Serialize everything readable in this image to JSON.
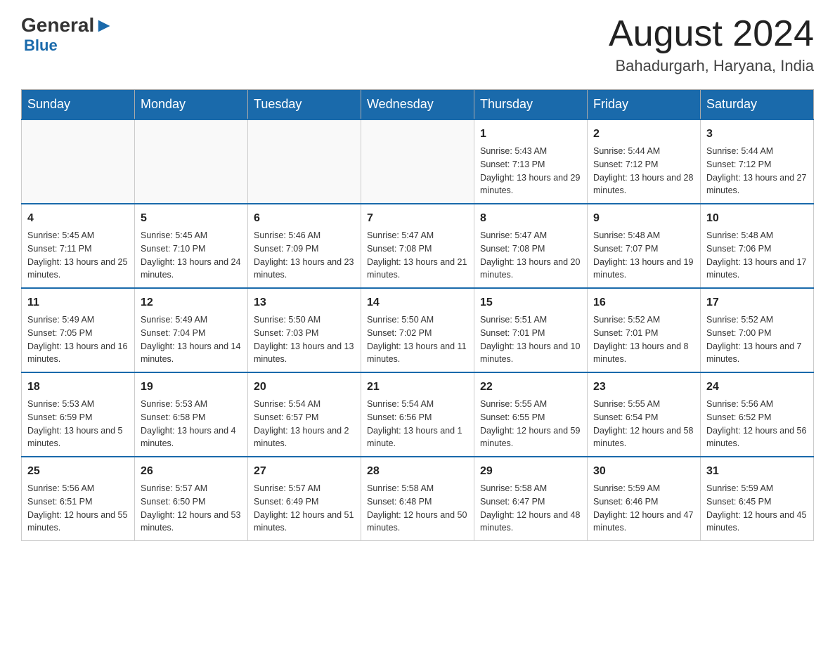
{
  "header": {
    "logo_general": "General",
    "logo_blue": "Blue",
    "month_title": "August 2024",
    "location": "Bahadurgarh, Haryana, India"
  },
  "calendar": {
    "days_of_week": [
      "Sunday",
      "Monday",
      "Tuesday",
      "Wednesday",
      "Thursday",
      "Friday",
      "Saturday"
    ],
    "weeks": [
      [
        {
          "day": "",
          "info": ""
        },
        {
          "day": "",
          "info": ""
        },
        {
          "day": "",
          "info": ""
        },
        {
          "day": "",
          "info": ""
        },
        {
          "day": "1",
          "info": "Sunrise: 5:43 AM\nSunset: 7:13 PM\nDaylight: 13 hours and 29 minutes."
        },
        {
          "day": "2",
          "info": "Sunrise: 5:44 AM\nSunset: 7:12 PM\nDaylight: 13 hours and 28 minutes."
        },
        {
          "day": "3",
          "info": "Sunrise: 5:44 AM\nSunset: 7:12 PM\nDaylight: 13 hours and 27 minutes."
        }
      ],
      [
        {
          "day": "4",
          "info": "Sunrise: 5:45 AM\nSunset: 7:11 PM\nDaylight: 13 hours and 25 minutes."
        },
        {
          "day": "5",
          "info": "Sunrise: 5:45 AM\nSunset: 7:10 PM\nDaylight: 13 hours and 24 minutes."
        },
        {
          "day": "6",
          "info": "Sunrise: 5:46 AM\nSunset: 7:09 PM\nDaylight: 13 hours and 23 minutes."
        },
        {
          "day": "7",
          "info": "Sunrise: 5:47 AM\nSunset: 7:08 PM\nDaylight: 13 hours and 21 minutes."
        },
        {
          "day": "8",
          "info": "Sunrise: 5:47 AM\nSunset: 7:08 PM\nDaylight: 13 hours and 20 minutes."
        },
        {
          "day": "9",
          "info": "Sunrise: 5:48 AM\nSunset: 7:07 PM\nDaylight: 13 hours and 19 minutes."
        },
        {
          "day": "10",
          "info": "Sunrise: 5:48 AM\nSunset: 7:06 PM\nDaylight: 13 hours and 17 minutes."
        }
      ],
      [
        {
          "day": "11",
          "info": "Sunrise: 5:49 AM\nSunset: 7:05 PM\nDaylight: 13 hours and 16 minutes."
        },
        {
          "day": "12",
          "info": "Sunrise: 5:49 AM\nSunset: 7:04 PM\nDaylight: 13 hours and 14 minutes."
        },
        {
          "day": "13",
          "info": "Sunrise: 5:50 AM\nSunset: 7:03 PM\nDaylight: 13 hours and 13 minutes."
        },
        {
          "day": "14",
          "info": "Sunrise: 5:50 AM\nSunset: 7:02 PM\nDaylight: 13 hours and 11 minutes."
        },
        {
          "day": "15",
          "info": "Sunrise: 5:51 AM\nSunset: 7:01 PM\nDaylight: 13 hours and 10 minutes."
        },
        {
          "day": "16",
          "info": "Sunrise: 5:52 AM\nSunset: 7:01 PM\nDaylight: 13 hours and 8 minutes."
        },
        {
          "day": "17",
          "info": "Sunrise: 5:52 AM\nSunset: 7:00 PM\nDaylight: 13 hours and 7 minutes."
        }
      ],
      [
        {
          "day": "18",
          "info": "Sunrise: 5:53 AM\nSunset: 6:59 PM\nDaylight: 13 hours and 5 minutes."
        },
        {
          "day": "19",
          "info": "Sunrise: 5:53 AM\nSunset: 6:58 PM\nDaylight: 13 hours and 4 minutes."
        },
        {
          "day": "20",
          "info": "Sunrise: 5:54 AM\nSunset: 6:57 PM\nDaylight: 13 hours and 2 minutes."
        },
        {
          "day": "21",
          "info": "Sunrise: 5:54 AM\nSunset: 6:56 PM\nDaylight: 13 hours and 1 minute."
        },
        {
          "day": "22",
          "info": "Sunrise: 5:55 AM\nSunset: 6:55 PM\nDaylight: 12 hours and 59 minutes."
        },
        {
          "day": "23",
          "info": "Sunrise: 5:55 AM\nSunset: 6:54 PM\nDaylight: 12 hours and 58 minutes."
        },
        {
          "day": "24",
          "info": "Sunrise: 5:56 AM\nSunset: 6:52 PM\nDaylight: 12 hours and 56 minutes."
        }
      ],
      [
        {
          "day": "25",
          "info": "Sunrise: 5:56 AM\nSunset: 6:51 PM\nDaylight: 12 hours and 55 minutes."
        },
        {
          "day": "26",
          "info": "Sunrise: 5:57 AM\nSunset: 6:50 PM\nDaylight: 12 hours and 53 minutes."
        },
        {
          "day": "27",
          "info": "Sunrise: 5:57 AM\nSunset: 6:49 PM\nDaylight: 12 hours and 51 minutes."
        },
        {
          "day": "28",
          "info": "Sunrise: 5:58 AM\nSunset: 6:48 PM\nDaylight: 12 hours and 50 minutes."
        },
        {
          "day": "29",
          "info": "Sunrise: 5:58 AM\nSunset: 6:47 PM\nDaylight: 12 hours and 48 minutes."
        },
        {
          "day": "30",
          "info": "Sunrise: 5:59 AM\nSunset: 6:46 PM\nDaylight: 12 hours and 47 minutes."
        },
        {
          "day": "31",
          "info": "Sunrise: 5:59 AM\nSunset: 6:45 PM\nDaylight: 12 hours and 45 minutes."
        }
      ]
    ]
  }
}
